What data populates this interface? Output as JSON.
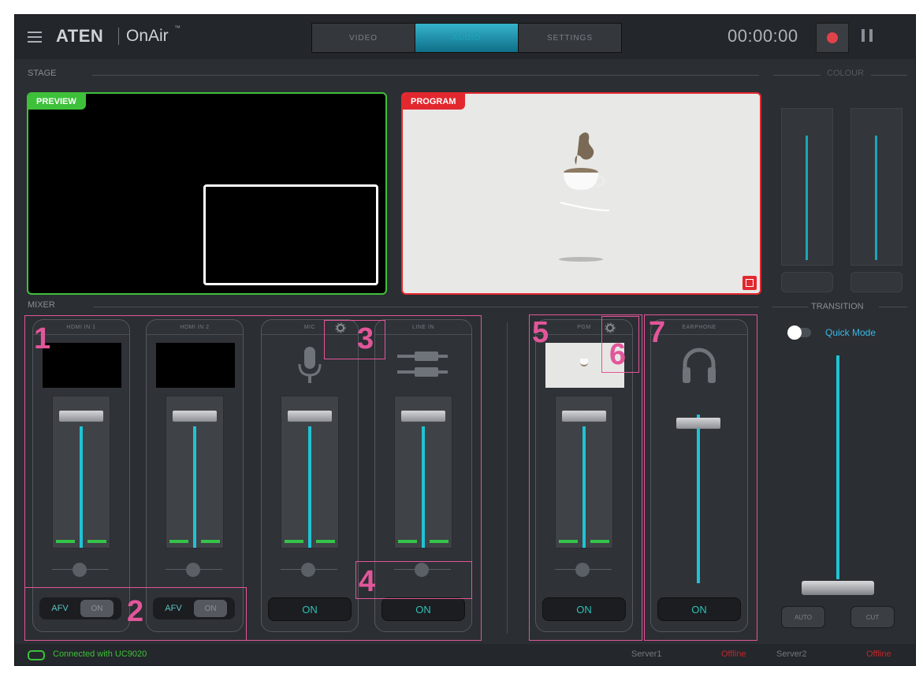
{
  "app": {
    "brand": "ATEN",
    "product": "OnAir",
    "trademark": "™"
  },
  "header": {
    "tabs": [
      {
        "label": "VIDEO"
      },
      {
        "label": "AUDIO",
        "active": true
      },
      {
        "label": "SETTINGS"
      }
    ],
    "timer": "00:00:00"
  },
  "stage": {
    "label": "STAGE",
    "preview_tag": "PREVIEW",
    "program_tag": "PROGRAM"
  },
  "colour": {
    "label": "COLOUR"
  },
  "mixer": {
    "label": "MIXER",
    "channels": [
      {
        "title": "HDMI IN 1",
        "button_a": "AFV",
        "button_b": "ON"
      },
      {
        "title": "HDMI IN 2",
        "button_a": "AFV",
        "button_b": "ON"
      },
      {
        "title": "MIC",
        "button": "ON"
      },
      {
        "title": "LINE IN",
        "button": "ON"
      },
      {
        "title": "PGM",
        "button": "ON"
      },
      {
        "title": "EARPHONE",
        "button": "ON"
      }
    ],
    "callouts": [
      "1",
      "2",
      "3",
      "4",
      "5",
      "6",
      "7"
    ]
  },
  "transition": {
    "label": "TRANSITION",
    "quick_mode": "Quick Mode",
    "auto": "AUTO",
    "cut": "CUT"
  },
  "status": {
    "connection": "Connected with UC9020",
    "server1": "Server1",
    "server1_status": "Offline",
    "server2": "Server2",
    "server2_status": "Offline"
  },
  "colors": {
    "accent": "#1fc4d4",
    "preview": "#3ec13a",
    "program": "#e2282e",
    "callout": "#e2569a"
  }
}
